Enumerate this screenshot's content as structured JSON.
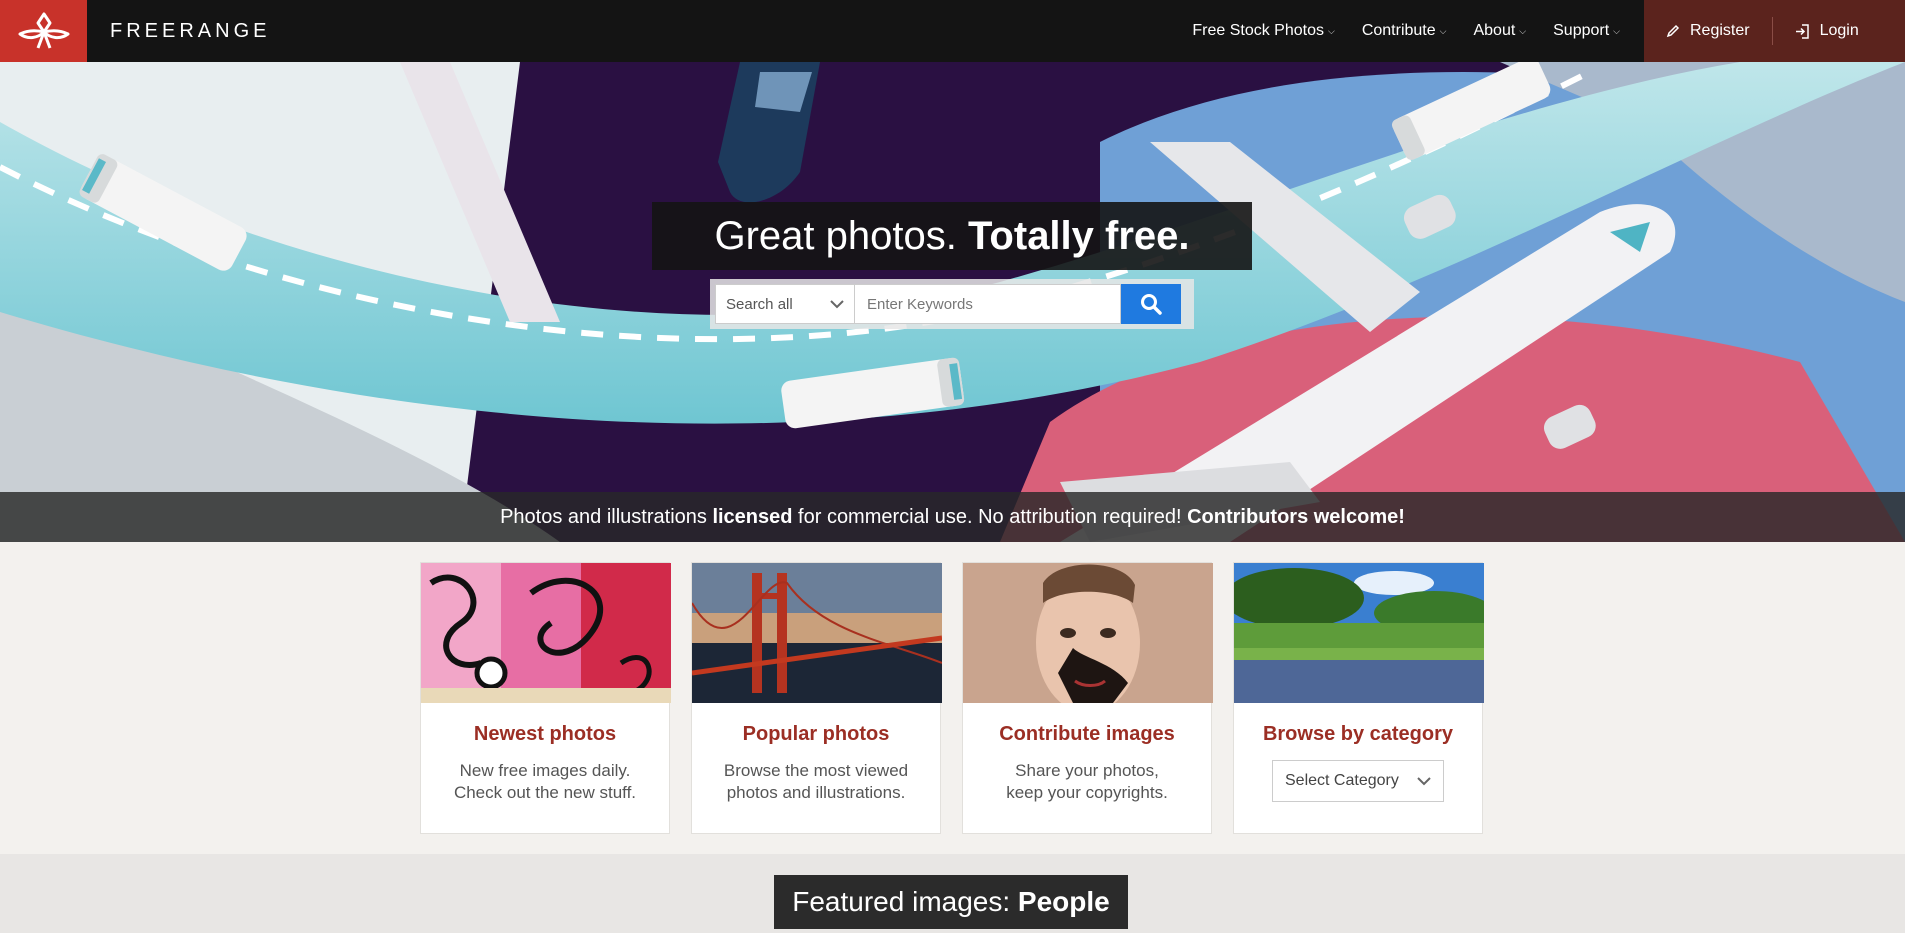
{
  "brand": {
    "name": "FREERANGE"
  },
  "nav": {
    "items": [
      {
        "label": "Free Stock Photos"
      },
      {
        "label": "Contribute"
      },
      {
        "label": "About"
      },
      {
        "label": "Support"
      }
    ],
    "register": "Register",
    "login": "Login"
  },
  "hero": {
    "headline_light": "Great photos. ",
    "headline_bold": "Totally free.",
    "search_scope": "Search all",
    "search_placeholder": "Enter Keywords"
  },
  "tagline": {
    "part1": "Photos and illustrations ",
    "bold1": "licensed",
    "part2": " for commercial use. No attribution required! ",
    "bold2": "Contributors welcome!"
  },
  "cards": [
    {
      "title": "Newest photos",
      "line1": "New free images daily.",
      "line2": "Check out the new stuff."
    },
    {
      "title": "Popular photos",
      "line1": "Browse the most viewed",
      "line2": "photos and illustrations."
    },
    {
      "title": "Contribute images",
      "line1": "Share your photos,",
      "line2": "keep your copyrights."
    },
    {
      "title": "Browse by category",
      "select": "Select Category"
    }
  ],
  "featured": {
    "light": "Featured images: ",
    "bold": "People"
  },
  "colors": {
    "accent": "#c8322a",
    "auth_bg": "#5b231d",
    "link": "#9b2e24",
    "search_btn": "#1f7ae0"
  }
}
